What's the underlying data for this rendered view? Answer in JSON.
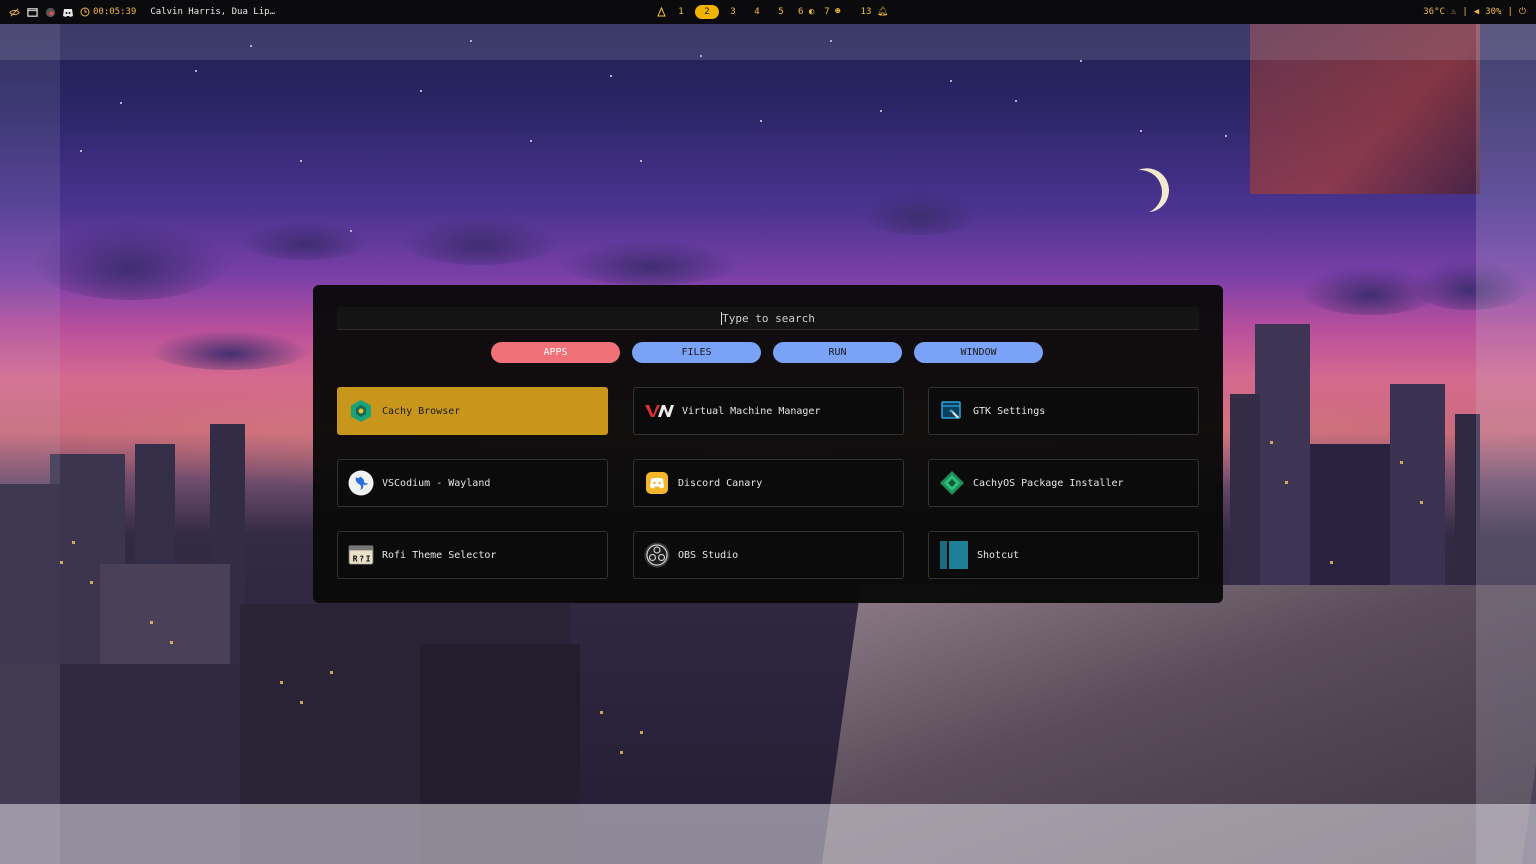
{
  "topbar": {
    "timer": "00:05:39",
    "media": "Calvin Harris, Dua Lip…",
    "workspaces": [
      "1",
      "2",
      "3",
      "4",
      "5",
      "6",
      "7"
    ],
    "active_workspace": "2",
    "notifications": "13",
    "temperature": "36°C",
    "volume": "30%",
    "separator": "|",
    "colors": {
      "accent": "#f0b400",
      "text": "#d8d8d8"
    }
  },
  "launcher": {
    "search_placeholder": "Type to search",
    "modes": [
      "APPS",
      "FILES",
      "RUN",
      "WINDOW"
    ],
    "active_mode": "APPS",
    "items": [
      {
        "label": "Cachy Browser",
        "icon": "cachy-browser-icon",
        "selected": true
      },
      {
        "label": "Virtual Machine Manager",
        "icon": "virt-manager-icon"
      },
      {
        "label": "GTK Settings",
        "icon": "gtk-settings-icon"
      },
      {
        "label": "VSCodium - Wayland",
        "icon": "vscodium-icon"
      },
      {
        "label": "Discord Canary",
        "icon": "discord-canary-icon"
      },
      {
        "label": "CachyOS Package Installer",
        "icon": "package-installer-icon"
      },
      {
        "label": "Rofi Theme Selector",
        "icon": "rofi-icon"
      },
      {
        "label": "OBS Studio",
        "icon": "obs-icon"
      },
      {
        "label": "Shotcut",
        "icon": "shotcut-icon"
      }
    ],
    "colors": {
      "selected": "#c8961a",
      "mode_active": "#f07178",
      "mode": "#7aa2f7"
    }
  }
}
